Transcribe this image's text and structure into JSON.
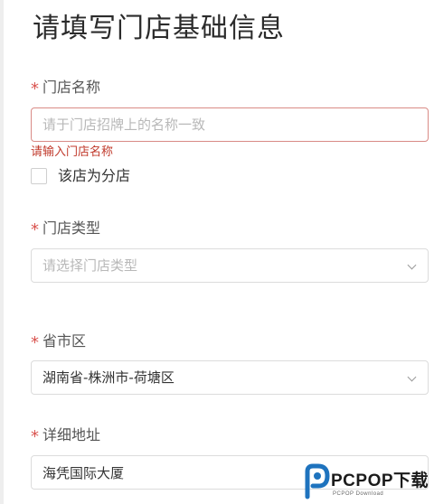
{
  "page": {
    "title": "请填写门店基础信息"
  },
  "form": {
    "required_mark": "*",
    "store_name": {
      "label": "门店名称",
      "placeholder": "请于门店招牌上的名称一致",
      "value": "",
      "error": "请输入门店名称"
    },
    "branch_checkbox": {
      "label": "该店为分店",
      "checked": false
    },
    "store_type": {
      "label": "门店类型",
      "placeholder": "请选择门店类型"
    },
    "region": {
      "label": "省市区",
      "value": "湖南省-株洲市-荷塘区"
    },
    "address": {
      "label": "详细地址",
      "value": "海凭国际大厦"
    }
  },
  "watermark": {
    "text": "PCPOP下载",
    "subtext": "PCPOP Download"
  },
  "colors": {
    "required": "#d9534f",
    "error_text": "#c0392b",
    "error_border": "#d98b86",
    "watermark_blue": "#1e73be",
    "border": "#dcdcdc"
  },
  "icons": {
    "select_arrow": "chevron-down-icon",
    "watermark": "pcpop-logo-icon"
  }
}
